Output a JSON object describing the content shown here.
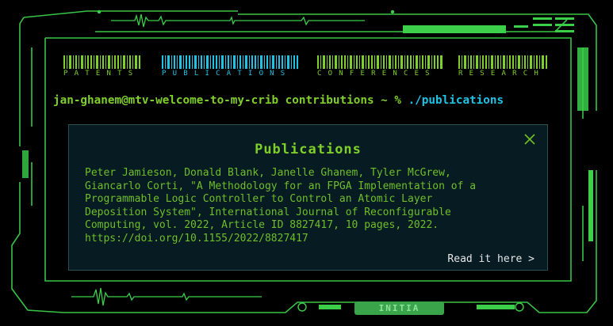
{
  "nav": {
    "items": [
      {
        "label": "PATENTS",
        "active": false
      },
      {
        "label": "PUBLICATIONS",
        "active": true
      },
      {
        "label": "CONFERENCES",
        "active": false
      },
      {
        "label": "RESEARCH",
        "active": false
      }
    ]
  },
  "prompt": {
    "user": "jan-ghanem@mtv-welcome-to-my-crib contributions ~ % ",
    "command": "./publications"
  },
  "panel": {
    "title": "Publications",
    "citation": "Peter Jamieson, Donald Blank, Janelle Ghanem, Tyler McGrew,\nGiancarlo Corti, \"A Methodology for an FPGA Implementation of a\nProgrammable Logic Controller to Control an Atomic Layer\nDeposition System\", International Journal of Reconfigurable\nComputing, vol. 2022, Article ID 8827417, 10 pages, 2022.\nhttps://doi.org/10.1155/2022/8827417",
    "read_link": "Read it here >"
  },
  "footer": {
    "init_label": "INITIA"
  },
  "colors": {
    "accent_green": "#7ecf2a",
    "accent_cyan": "#1fc3e6",
    "panel_bg": "#061b22"
  }
}
